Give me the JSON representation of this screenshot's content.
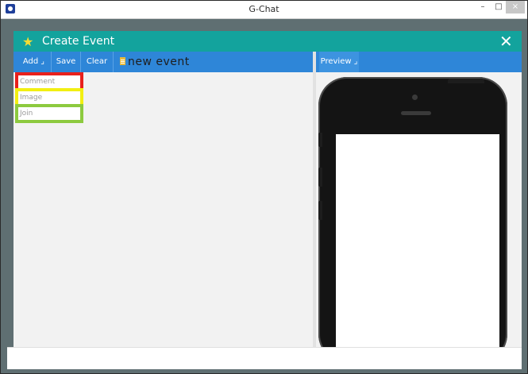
{
  "app": {
    "title": "G-Chat",
    "window_controls": {
      "minimize": "–",
      "maximize": "□",
      "close": "×"
    }
  },
  "dialog": {
    "title": "Create Event",
    "star_icon": "★",
    "close_icon": "✕"
  },
  "toolbar": {
    "add_label": "Add ⌟",
    "save_label": "Save",
    "clear_label": "Clear",
    "event_name": "new event"
  },
  "components": [
    {
      "label": "Comment",
      "border_color": "#e8201c"
    },
    {
      "label": "Image",
      "border_color": "#f2ef12"
    },
    {
      "label": "Join",
      "border_color": "#8dca3f"
    }
  ],
  "preview": {
    "button_label": "Preview ⌟"
  },
  "colors": {
    "header": "#13a39d",
    "toolbar": "#2e86d8",
    "star": "#f6dc32"
  }
}
